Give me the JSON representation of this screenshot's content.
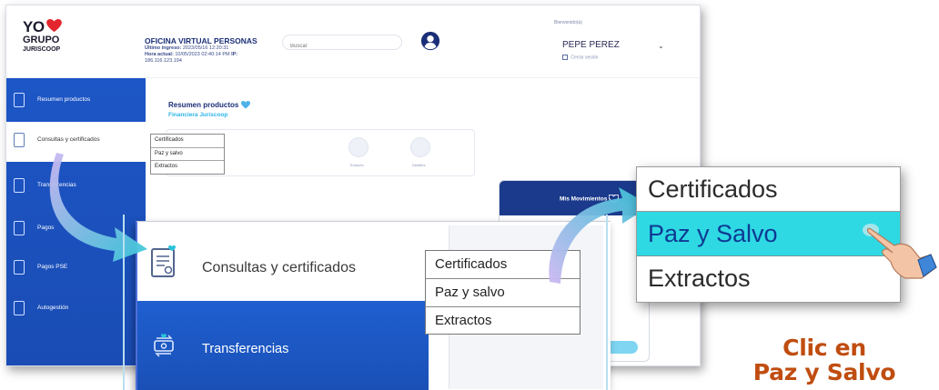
{
  "brand": {
    "line1": "YO",
    "line2": "GRUPO",
    "line3": "JURISCOOP",
    "heart_color": "#e3262e"
  },
  "header": {
    "office_title": "OFICINA VIRTUAL PERSONAS",
    "last_login_label": "Último ingreso:",
    "last_login_value": "2023/05/16 12:20:31",
    "current_time_label": "Hora actual:",
    "current_time_value": "10/05/2023 02:40:14 PM",
    "ip_label": "IP:",
    "ip_value": "186.116.123.194",
    "search_placeholder": "Buscar",
    "welcome": "Bienvenido(a)",
    "user_name": "PEPE PEREZ",
    "logout": "Cerrar sesión"
  },
  "sidebar": {
    "items": [
      {
        "label": "Resumen productos"
      },
      {
        "label": "Consultas y certificados"
      },
      {
        "label": "Transferencias"
      },
      {
        "label": "Pagos"
      },
      {
        "label": "Pagos PSE"
      },
      {
        "label": "Autogestión"
      }
    ],
    "active_index": 1,
    "color": "#1d56c6"
  },
  "content": {
    "title": "Resumen productos",
    "subtitle": "Financiera Juriscoop",
    "product_items": [
      "Extracto",
      "Detalles"
    ],
    "movements_title": "Mis Movimientos"
  },
  "mini_dropdown": [
    "Certificados",
    "Paz y salvo",
    "Extractos"
  ],
  "zoom1": {
    "label": "Consultas y certificados",
    "next_label": "Transferencias",
    "dropdown": [
      "Certificados",
      "Paz y salvo",
      "Extractos"
    ]
  },
  "zoom2": {
    "options": [
      "Certificados",
      "Paz y Salvo",
      "Extractos"
    ],
    "highlight_color": "#2ed9e3"
  },
  "caption": {
    "line1": "Clic en",
    "line2": "Paz y Salvo",
    "color": "#c04d10"
  }
}
